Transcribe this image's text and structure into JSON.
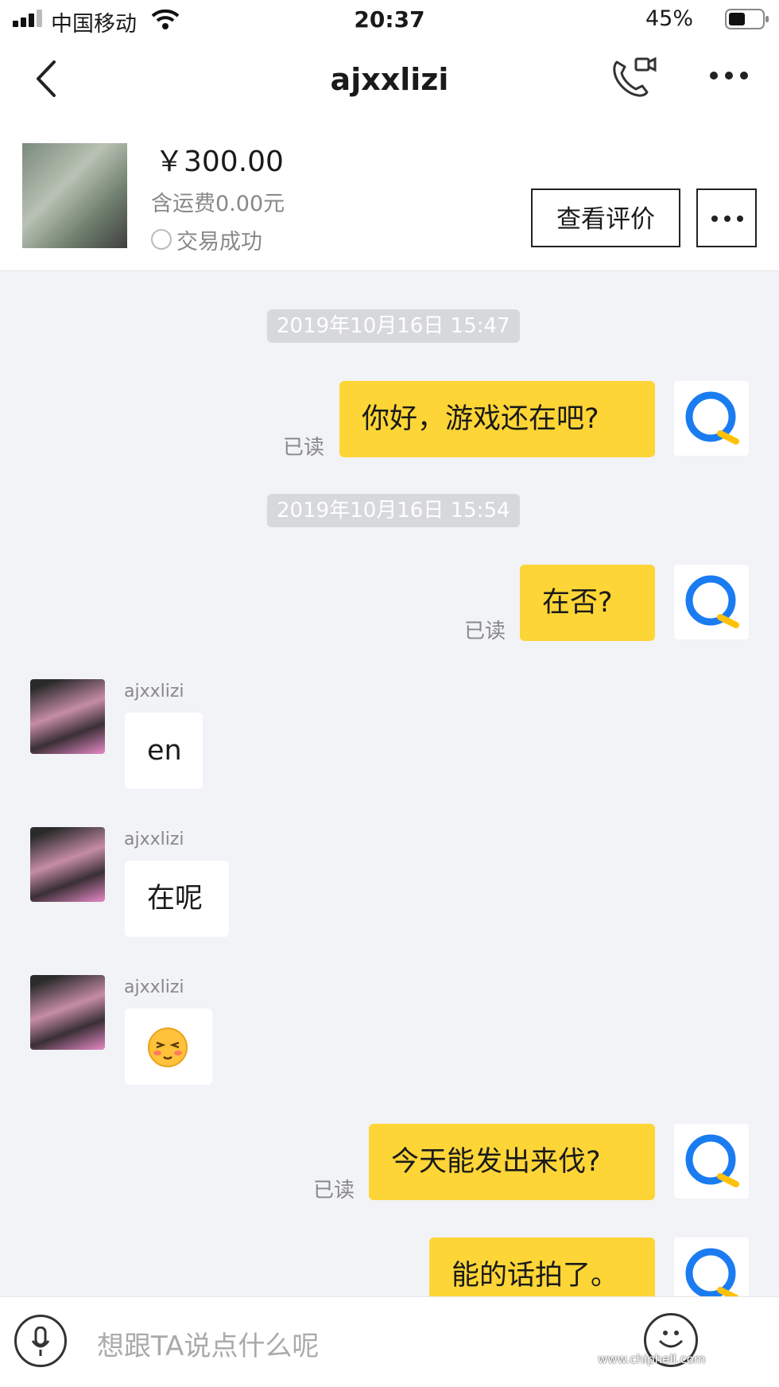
{
  "status_bar": {
    "carrier": "中国移动",
    "time": "20:37",
    "battery": "45%"
  },
  "nav": {
    "title": "ajxxlizi"
  },
  "product": {
    "price": "￥300.00",
    "shipping": "含运费0.00元",
    "deal_status": "交易成功",
    "review_button": "查看评价"
  },
  "chat": {
    "times": [
      "2019年10月16日 15:47",
      "2019年10月16日 15:54"
    ],
    "read_label": "已读",
    "sender_name": "ajxxlizi",
    "messages": [
      {
        "from": "me",
        "text": "你好，游戏还在吧?"
      },
      {
        "from": "me",
        "text": "在否?"
      },
      {
        "from": "them",
        "text": "en"
      },
      {
        "from": "them",
        "text": "在呢"
      },
      {
        "from": "them",
        "text": "",
        "emoji": "blushing-face"
      },
      {
        "from": "me",
        "text": "今天能发出来伐?"
      },
      {
        "from": "me",
        "text": "能的话拍了。"
      }
    ]
  },
  "input": {
    "placeholder": "想跟TA说点什么呢"
  },
  "watermark": "www.chiphell.com",
  "colors": {
    "my_bubble": "#fdd536",
    "their_bubble": "#ffffff",
    "chat_bg": "#f2f3f7",
    "qq_blue": "#1a7cf0"
  }
}
